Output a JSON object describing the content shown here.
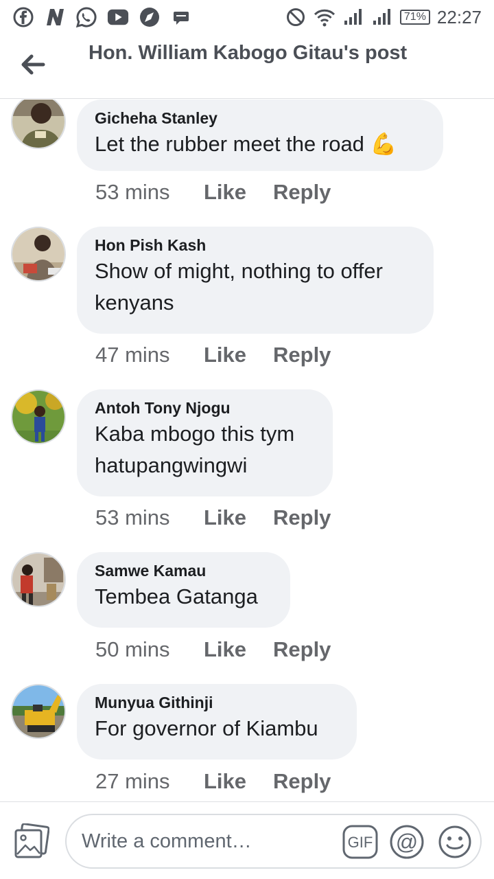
{
  "status_bar": {
    "notification_icons": [
      "facebook-icon",
      "n-news-icon",
      "whatsapp-icon",
      "youtube-icon",
      "compass-icon",
      "message-icon"
    ],
    "battery": "71%",
    "time": "22:27"
  },
  "header": {
    "title": "Hon. William Kabogo Gitau's post"
  },
  "comments": [
    {
      "author": "Gicheha Stanley",
      "text": "Let the rubber meet the road 💪",
      "time": "53 mins",
      "like": "Like",
      "reply": "Reply"
    },
    {
      "author": "Hon Pish Kash",
      "text": "Show of might, nothing to offer kenyans",
      "time": "47 mins",
      "like": "Like",
      "reply": "Reply"
    },
    {
      "author": "Antoh Tony Njogu",
      "text": "Kaba mbogo this tym hatupangwingwi",
      "time": "53 mins",
      "like": "Like",
      "reply": "Reply"
    },
    {
      "author": "Samwe Kamau",
      "text": "Tembea Gatanga",
      "time": "50 mins",
      "like": "Like",
      "reply": "Reply"
    },
    {
      "author": "Munyua Githinji",
      "text": "For governor of Kiambu",
      "time": "27 mins",
      "like": "Like",
      "reply": "Reply"
    }
  ],
  "composer": {
    "placeholder": "Write a comment…",
    "gif_label": "GIF",
    "mention_label": "@"
  },
  "colors": {
    "bubble": "#f0f2f5",
    "text": "#1c1e21",
    "meta": "#65676b",
    "header_text": "#4b4f56"
  }
}
